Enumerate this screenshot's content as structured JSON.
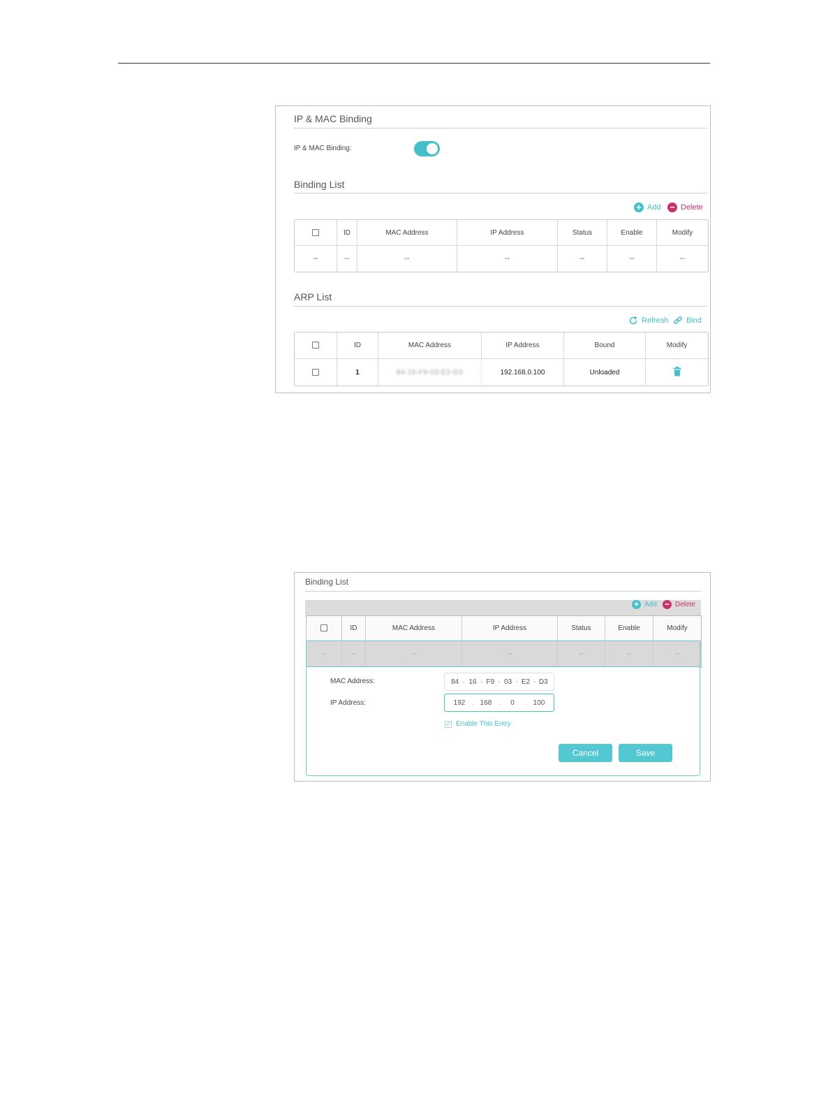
{
  "panel1": {
    "title": "IP & MAC Binding",
    "toggle_label": "IP & MAC Binding:",
    "toggle_on": true,
    "binding_list": {
      "title": "Binding List",
      "add_label": "Add",
      "delete_label": "Delete",
      "columns": [
        "ID",
        "MAC Address",
        "IP Address",
        "Status",
        "Enable",
        "Modify"
      ],
      "row": [
        "--",
        "--",
        "--",
        "--",
        "--",
        "--",
        "--"
      ]
    },
    "arp_list": {
      "title": "ARP List",
      "refresh_label": "Refresh",
      "bind_label": "Bind",
      "columns": [
        "ID",
        "MAC Address",
        "IP Address",
        "Bound",
        "Modify"
      ],
      "rows": [
        {
          "id": "1",
          "mac": "84-16-F9-03-E2-D3",
          "ip": "192.168.0.100",
          "bound": "Unloaded"
        }
      ]
    }
  },
  "panel2": {
    "title": "Binding List",
    "add_label": "Add",
    "delete_label": "Delete",
    "columns": [
      "ID",
      "MAC Address",
      "IP Address",
      "Status",
      "Enable",
      "Modify"
    ],
    "row": [
      "--",
      "--",
      "--",
      "--",
      "--",
      "--",
      "--"
    ],
    "form": {
      "mac_label": "MAC Address:",
      "mac": [
        "84",
        "16",
        "F9",
        "03",
        "E2",
        "D3"
      ],
      "ip_label": "IP Address:",
      "ip": [
        "192",
        "168",
        "0",
        "100"
      ],
      "enable_label": "Enable This Entry",
      "cancel_label": "Cancel",
      "save_label": "Save"
    }
  },
  "colors": {
    "accent": "#44c0c8",
    "danger": "#c9316b"
  }
}
